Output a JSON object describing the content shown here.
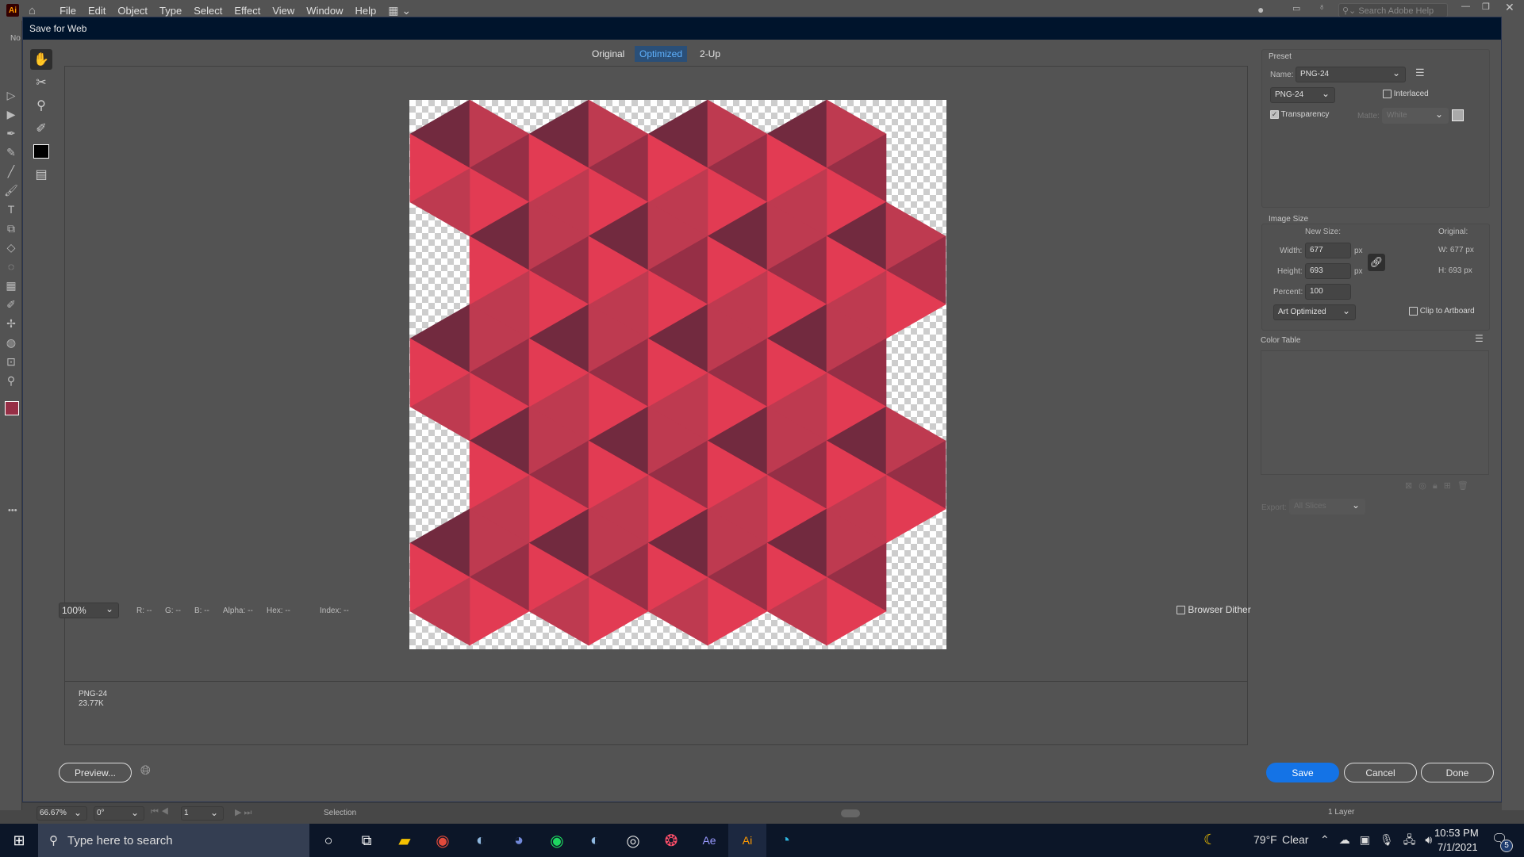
{
  "app": {
    "logo": "Ai",
    "menu": [
      "File",
      "Edit",
      "Object",
      "Type",
      "Select",
      "Effect",
      "View",
      "Window",
      "Help"
    ],
    "help_search_placeholder": "Search Adobe Help",
    "doc_tab_fragment": "No"
  },
  "dialog": {
    "title": "Save for Web",
    "tabs": [
      {
        "label": "Original",
        "active": false
      },
      {
        "label": "Optimized",
        "active": true
      },
      {
        "label": "2-Up",
        "active": false
      }
    ],
    "tools": [
      "hand-icon",
      "slice-select-icon",
      "zoom-icon",
      "eyedropper-icon",
      "eyedropper-color-icon",
      "toggle-slices-icon"
    ],
    "artwork_colors": {
      "dark": "#722a3f",
      "medium": "#be3a50",
      "mid_dark": "#962f46",
      "bright": "#e23b53"
    },
    "info": {
      "format": "PNG-24",
      "size": "23.77K"
    },
    "zoom": "100%",
    "readouts": [
      "R: --",
      "G: --",
      "B: --",
      "Alpha: --",
      "Hex: --",
      "Index: --"
    ],
    "browser_dither": {
      "label": "Browser Dither",
      "checked": false
    },
    "buttons": {
      "preview": "Preview...",
      "save": "Save",
      "cancel": "Cancel",
      "done": "Done"
    },
    "accent": "#1473e6"
  },
  "panel": {
    "preset": {
      "title": "Preset",
      "name_label": "Name:",
      "name_value": "PNG-24",
      "format": "PNG-24",
      "interlaced": {
        "label": "Interlaced",
        "checked": false
      },
      "transparency": {
        "label": "Transparency",
        "checked": true
      },
      "matte_label": "Matte:",
      "matte_value": "White"
    },
    "image_size": {
      "title": "Image Size",
      "new_size": "New Size:",
      "width_label": "Width:",
      "width": "677",
      "height_label": "Height:",
      "height": "693",
      "unit": "px",
      "percent_label": "Percent:",
      "percent": "100",
      "quality": "Art Optimized",
      "original_label": "Original:",
      "orig_w": "W:  677 px",
      "orig_h": "H:  693 px",
      "clip": {
        "label": "Clip to Artboard",
        "checked": false
      }
    },
    "color_table": {
      "title": "Color Table"
    },
    "export": {
      "label": "Export:",
      "value": "All Slices"
    }
  },
  "status": {
    "zoom": "66.67%",
    "rotation": "0°",
    "artboard": "1",
    "tool": "Selection",
    "layers": "1 Layer"
  },
  "taskbar": {
    "search_placeholder": "Type here to search",
    "apps": [
      "file-explorer-icon",
      "chrome-icon",
      "steam-icon",
      "discord-icon",
      "spotify-icon",
      "steam-icon",
      "obs-icon",
      "creative-cloud-icon",
      "after-effects-icon",
      "illustrator-icon",
      "edge-icon"
    ],
    "weather": "79°F",
    "weather_desc": "Clear",
    "time": "10:53 PM",
    "date": "7/1/2021",
    "notifications": "5"
  }
}
